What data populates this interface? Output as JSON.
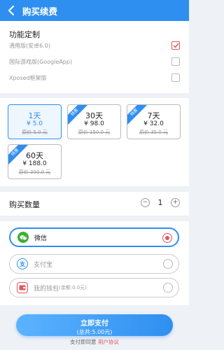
{
  "header": {
    "title": "购买续费"
  },
  "features": {
    "title": "功能定制",
    "options": [
      {
        "label": "通用版(安卓6.0)",
        "checked": true
      },
      {
        "label": "国际游戏版(GoogleApp)",
        "checked": false
      },
      {
        "label": "Xposed框架版",
        "checked": false
      }
    ]
  },
  "plans": [
    {
      "days": "1天",
      "price": "¥ 5.0",
      "original": "原价 5.0 元",
      "ribbon": "",
      "selected": true
    },
    {
      "days": "30天",
      "price": "¥ 98.0",
      "original": "原价 150.0 元",
      "ribbon": "特惠",
      "selected": false
    },
    {
      "days": "7天",
      "price": "¥ 32.0",
      "original": "原价 35.0 元",
      "ribbon": "特惠",
      "selected": false
    },
    {
      "days": "60天",
      "price": "¥ 188.0",
      "original": "原价 300.0 元",
      "ribbon": "特惠",
      "selected": false
    }
  ],
  "quantity": {
    "label": "购买数量",
    "minus": "−",
    "value": "1",
    "plus": "+"
  },
  "payment": {
    "options": [
      {
        "name": "微信",
        "sub": "",
        "icon": "wechat-icon",
        "color": "#3cb034",
        "selected": true
      },
      {
        "name": "支付宝",
        "sub": "",
        "icon": "alipay-icon",
        "color": "#2f8ff0",
        "selected": false
      },
      {
        "name": "我的钱包",
        "sub": "(余额:0.0元)",
        "icon": "wallet-icon",
        "color": "#e0575b",
        "selected": false
      }
    ]
  },
  "footer": {
    "pay_label": "立即支付",
    "total": "(总共:5.00元)",
    "agree_text": "支付即同意 ",
    "agree_link": "用户协议"
  },
  "colors": {
    "accent": "#2f8ff0",
    "danger": "#e0575b",
    "wechat": "#3cb034"
  }
}
